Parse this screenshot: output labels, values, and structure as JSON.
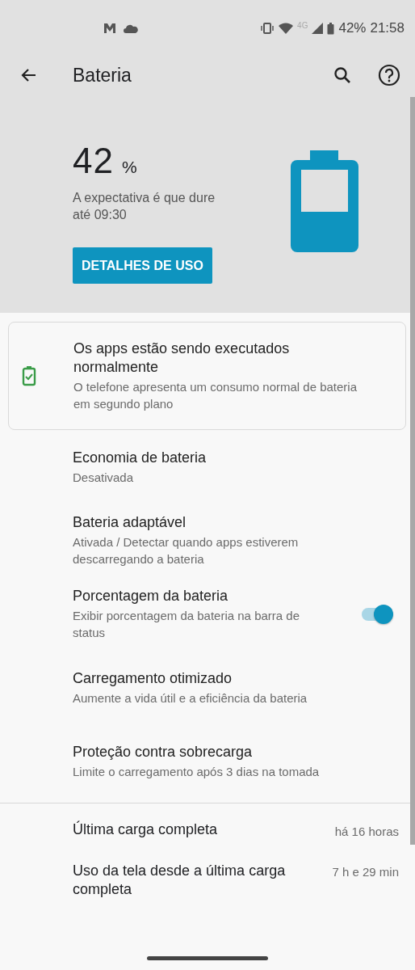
{
  "status_bar": {
    "signal_label": "4G",
    "battery": "42%",
    "time": "21:58"
  },
  "toolbar": {
    "title": "Bateria"
  },
  "header": {
    "percent": "42",
    "unit": "%",
    "estimate": "A expectativa é que dure até 09:30",
    "button": "DETALHES DE USO"
  },
  "tip_card": {
    "title": "Os apps estão sendo executados normalmente",
    "summary": "O telefone apresenta um consumo normal de bateria em segundo plano"
  },
  "settings": [
    {
      "kind": "plain",
      "title": "Economia de bateria",
      "summary": "Desativada"
    },
    {
      "kind": "plain",
      "title": "Bateria adaptável",
      "summary": "Ativada / Detectar quando apps estiverem descarregando a bateria"
    },
    {
      "kind": "switch",
      "title": "Porcentagem da bateria",
      "summary": "Exibir porcentagem da bateria na barra de status",
      "on": true
    },
    {
      "kind": "plain",
      "title": "Carregamento otimizado",
      "summary": "Aumente a vida útil e a eficiência da bateria"
    },
    {
      "kind": "plain",
      "title": "Proteção contra sobrecarga",
      "summary": "Limite o carregamento após 3 dias na tomada"
    }
  ],
  "usage": [
    {
      "label": "Última carga completa",
      "value": "há 16 horas"
    },
    {
      "label": "Uso da tela desde a última carga completa",
      "value": "7 h e 29 min"
    }
  ]
}
